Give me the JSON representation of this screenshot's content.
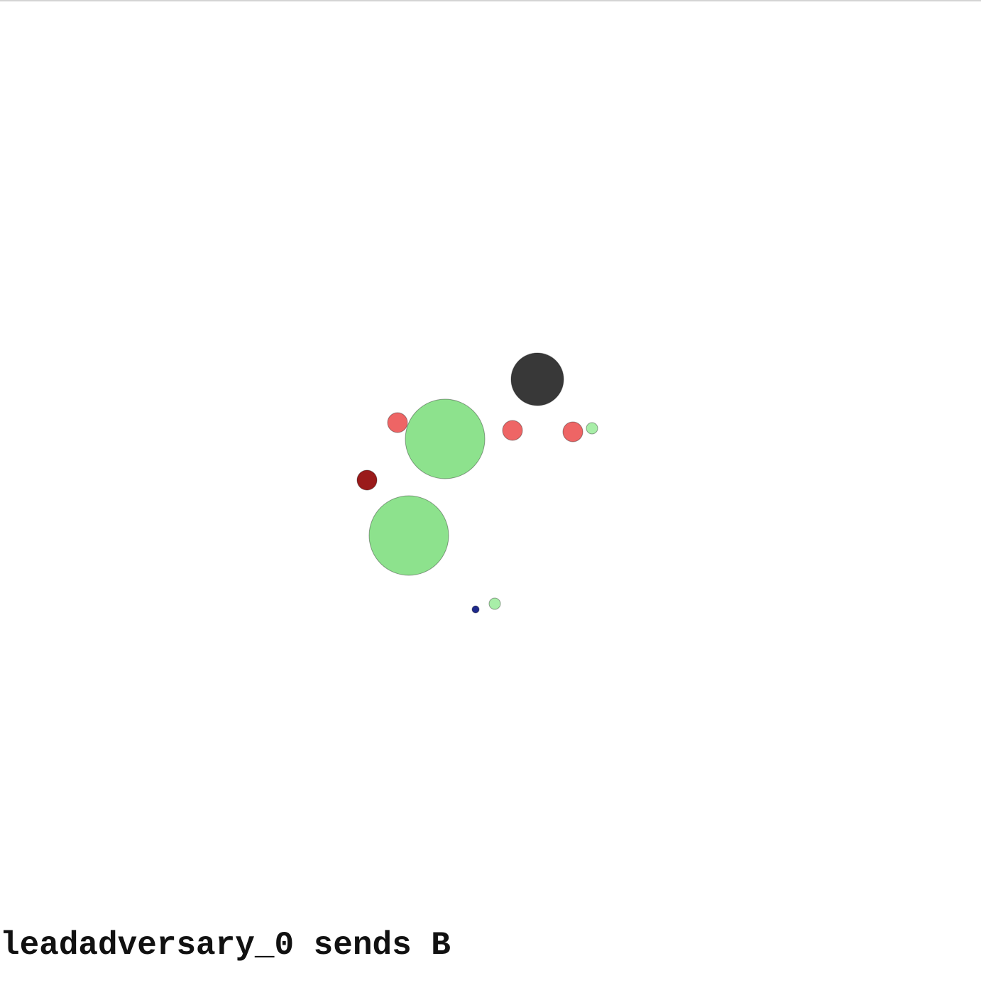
{
  "message": {
    "text": "leadadversary_0 sends B"
  },
  "colors": {
    "background": "#ffffff",
    "forest": "#8de28d",
    "food": "#a8eea8",
    "adversary": "#ee6565",
    "lead_adversary": "#9a1a1a",
    "good_agent": "#1f2a8c",
    "obstacle": "#383838"
  },
  "entities": [
    {
      "kind": "obstacle",
      "name": "obstacle"
    },
    {
      "kind": "forest",
      "name": "forest-1"
    },
    {
      "kind": "forest",
      "name": "forest-2"
    },
    {
      "kind": "adversary",
      "name": "adversary-1"
    },
    {
      "kind": "adversary",
      "name": "adversary-2"
    },
    {
      "kind": "adversary",
      "name": "adversary-3"
    },
    {
      "kind": "lead_adversary",
      "name": "lead-adversary"
    },
    {
      "kind": "food",
      "name": "food-1"
    },
    {
      "kind": "food",
      "name": "food-2"
    },
    {
      "kind": "good_agent",
      "name": "good-agent"
    }
  ]
}
